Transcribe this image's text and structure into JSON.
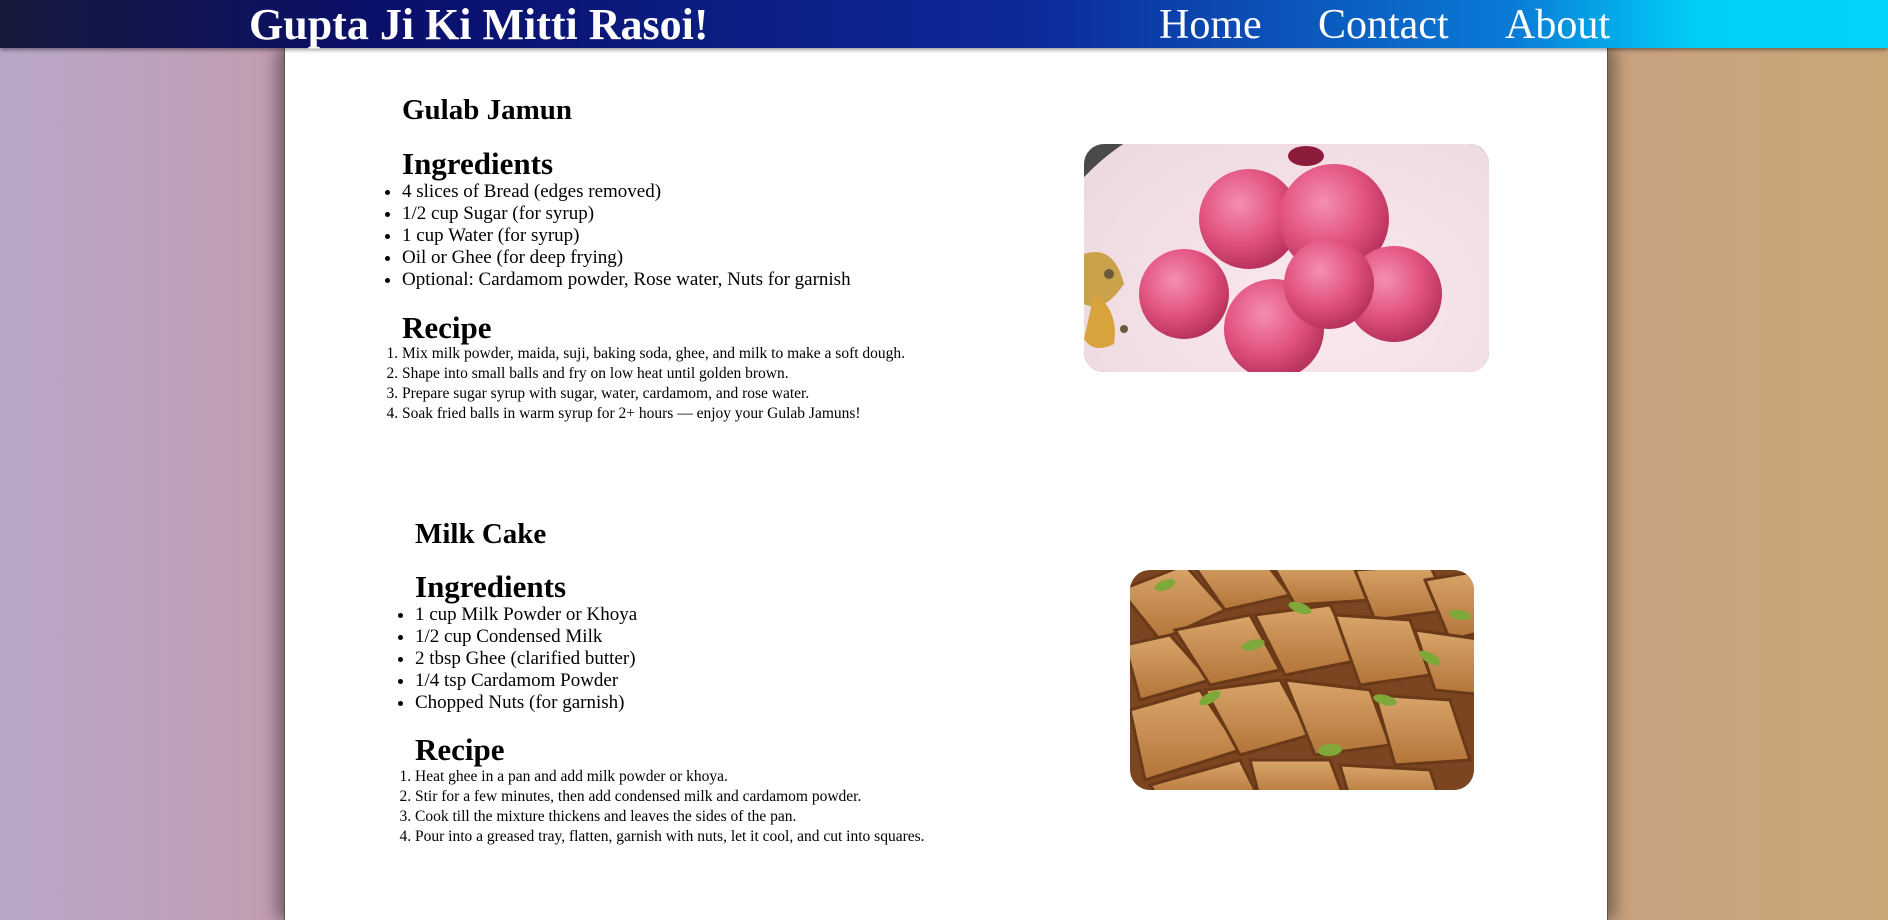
{
  "header": {
    "title": "Gupta Ji Ki Mitti Rasoi!",
    "nav": [
      "Home",
      "Contact",
      "About"
    ]
  },
  "recipes": [
    {
      "name": "Gulab Jamun",
      "ingredients_heading": "Ingredients",
      "ingredients": [
        "4 slices of Bread (edges removed)",
        "1/2 cup Sugar (for syrup)",
        "1 cup Water (for syrup)",
        "Oil or Ghee (for deep frying)",
        "Optional: Cardamom powder, Rose water, Nuts for garnish"
      ],
      "recipe_heading": "Recipe",
      "steps": [
        "Mix milk powder, maida, suji, baking soda, ghee, and milk to make a soft dough.",
        "Shape into small balls and fry on low heat until golden brown.",
        "Prepare sugar syrup with sugar, water, cardamom, and rose water.",
        "Soak fried balls in warm syrup for 2+ hours — enjoy your Gulab Jamuns!"
      ]
    },
    {
      "name": "Milk Cake",
      "ingredients_heading": "Ingredients",
      "ingredients": [
        "1 cup Milk Powder or Khoya",
        "1/2 cup Condensed Milk",
        "2 tbsp Ghee (clarified butter)",
        "1/4 tsp Cardamom Powder",
        "Chopped Nuts (for garnish)"
      ],
      "recipe_heading": "Recipe",
      "steps": [
        "Heat ghee in a pan and add milk powder or khoya.",
        "Stir for a few minutes, then add condensed milk and cardamom powder.",
        "Cook till the mixture thickens and leaves the sides of the pan.",
        "Pour into a greased tray, flatten, garnish with nuts, let it cool, and cut into squares."
      ]
    }
  ]
}
